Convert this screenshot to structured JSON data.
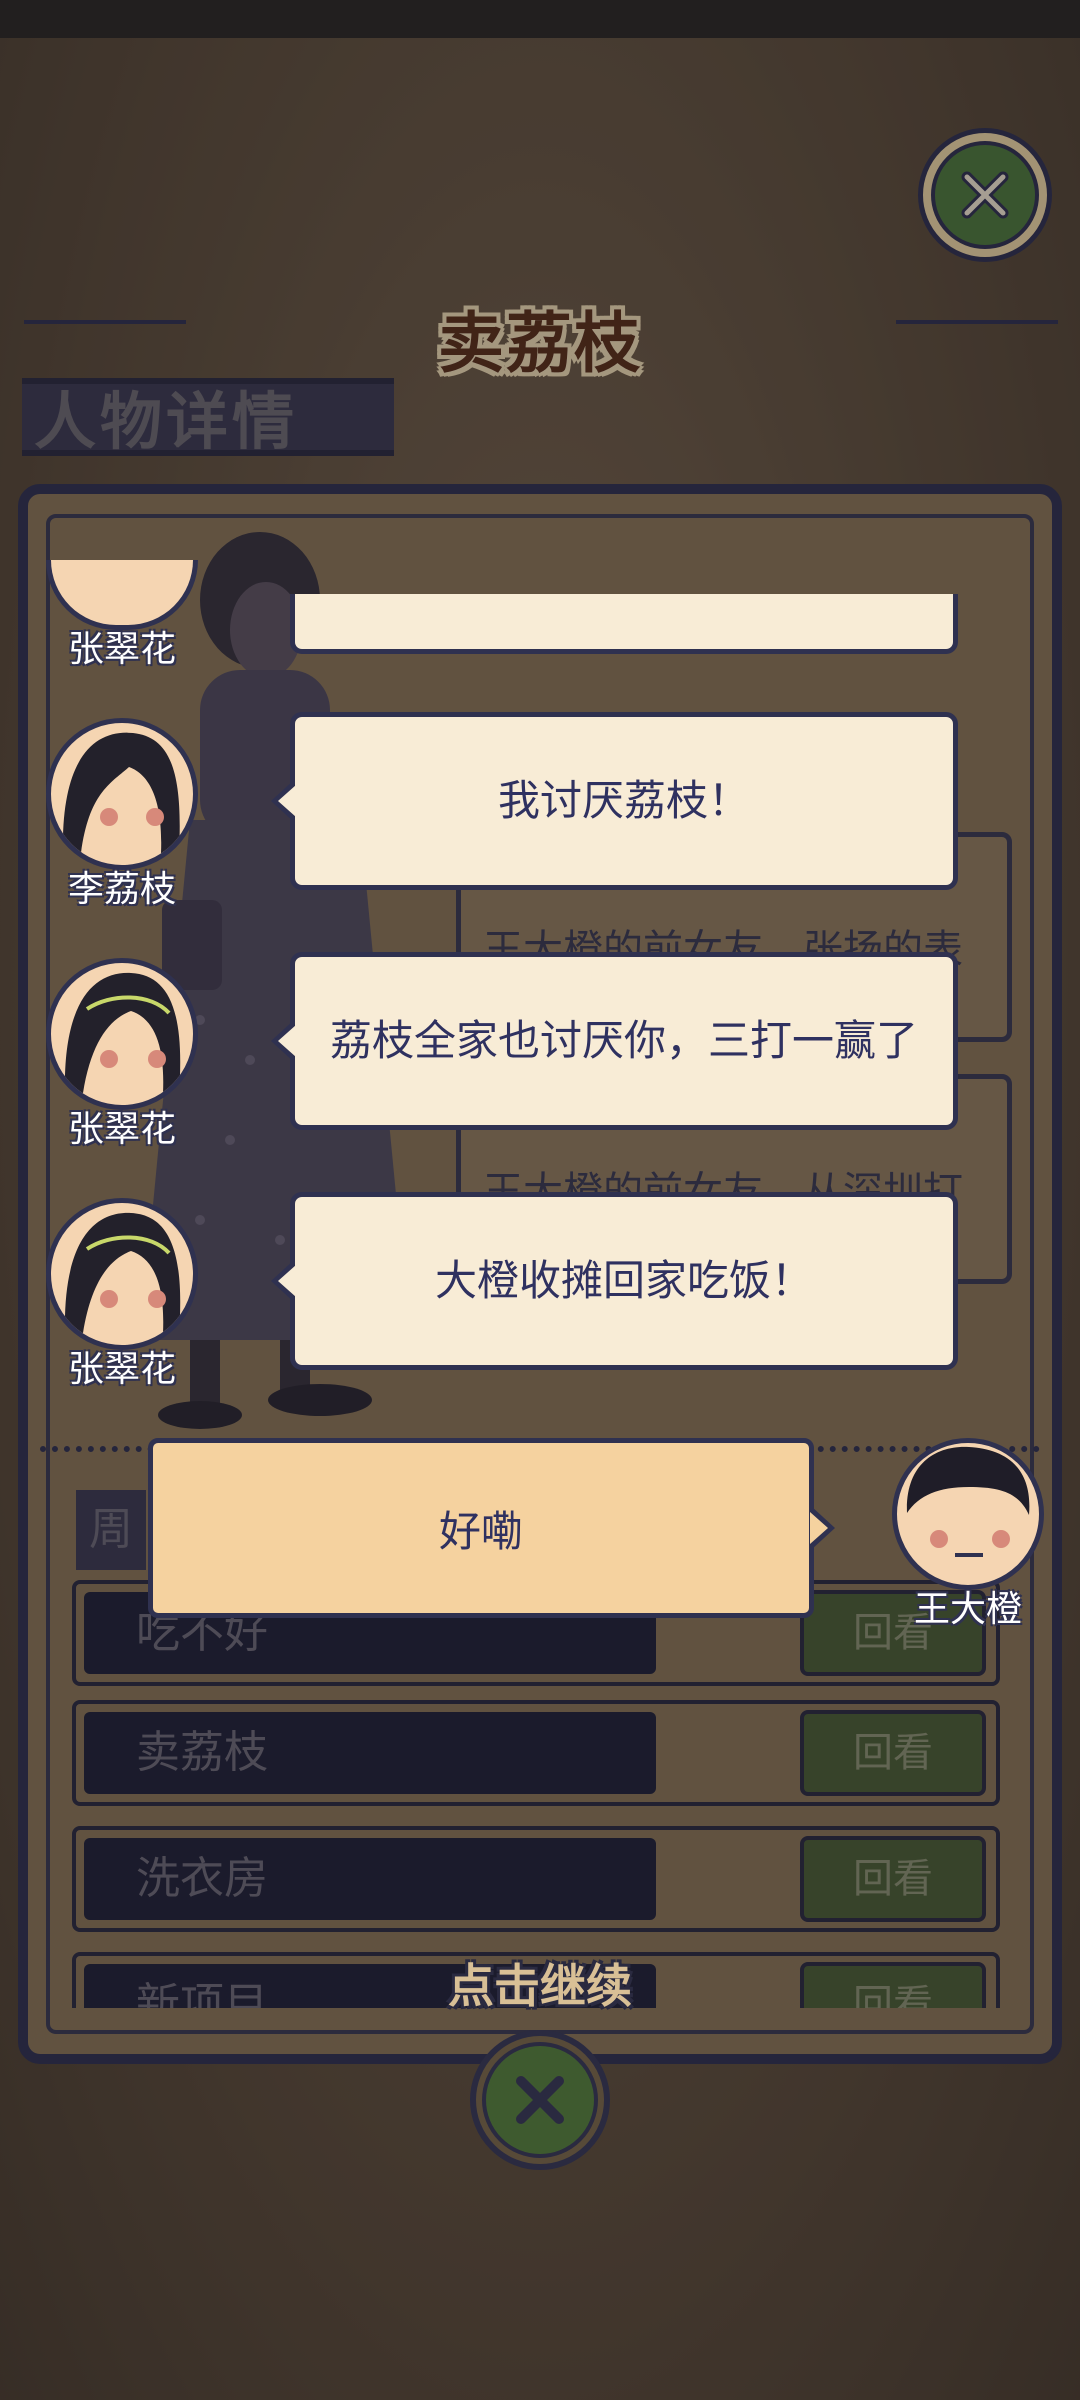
{
  "header": {
    "title": "卖荔枝",
    "section_label": "人物详情"
  },
  "background_cards": [
    {
      "text": "王大橙的前女友，张扬的表"
    },
    {
      "text": "王大橙的前女友，从深圳打"
    }
  ],
  "list": {
    "partial_label": "周",
    "rows": [
      {
        "label": "吃不好",
        "button": "回看"
      },
      {
        "label": "卖荔枝",
        "button": "回看"
      },
      {
        "label": "洗衣房",
        "button": "回看"
      },
      {
        "label": "新项目",
        "button": "回看"
      }
    ]
  },
  "chat": {
    "messages": [
      {
        "speaker": "张翠花",
        "text": ""
      },
      {
        "speaker": "李荔枝",
        "text": "我讨厌荔枝！"
      },
      {
        "speaker": "张翠花",
        "text": "荔枝全家也讨厌你，三打一赢了"
      },
      {
        "speaker": "张翠花",
        "text": "大橙收摊回家吃饭！"
      }
    ],
    "player": {
      "speaker": "王大橙",
      "text": "好嘞"
    }
  },
  "footer": {
    "continue_label": "点击继续"
  },
  "colors": {
    "navy": "#2f3150",
    "bubble": "#f8ecd6",
    "player_bubble": "#f5d29f",
    "button_green": "#4e7a3c"
  },
  "icons": {
    "close_top": "close-icon",
    "close_bottom": "close-icon"
  }
}
